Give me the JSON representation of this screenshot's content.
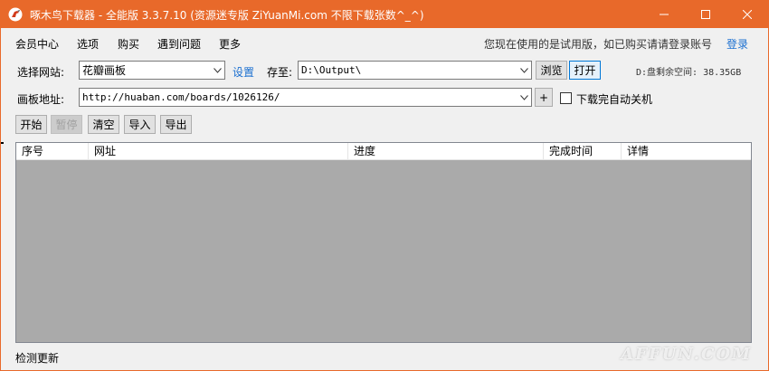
{
  "window": {
    "title": "啄木鸟下载器 - 全能版 3.3.7.10 (资源迷专版 ZiYuanMi.com 不限下载张数^_^)",
    "accent": "#e8692a"
  },
  "menu": {
    "items": [
      "会员中心",
      "选项",
      "购买",
      "遇到问题",
      "更多"
    ],
    "trial_notice": "您现在使用的是试用版，如已购买请请登录账号",
    "login_label": "登录"
  },
  "site_row": {
    "label": "选择网站:",
    "site_value": "花瓣画板",
    "settings_label": "设置",
    "save_label": "存至:",
    "save_path": "D:\\Output\\",
    "browse_label": "浏览",
    "open_label": "打开",
    "disk_space": "D:盘剩余空间: 38.35GB"
  },
  "url_row": {
    "label": "画板地址:",
    "url_value": "http://huaban.com/boards/1026126/",
    "add_label": "+",
    "shutdown_label": "下载完自动关机"
  },
  "actions": {
    "start": "开始",
    "pause": "暂停",
    "clear": "清空",
    "import": "导入",
    "export": "导出"
  },
  "table": {
    "columns": [
      "序号",
      "网址",
      "进度",
      "完成时间",
      "详情"
    ]
  },
  "status": {
    "text": "检测更新"
  },
  "watermark": {
    "text": "AFFUN.COM"
  }
}
